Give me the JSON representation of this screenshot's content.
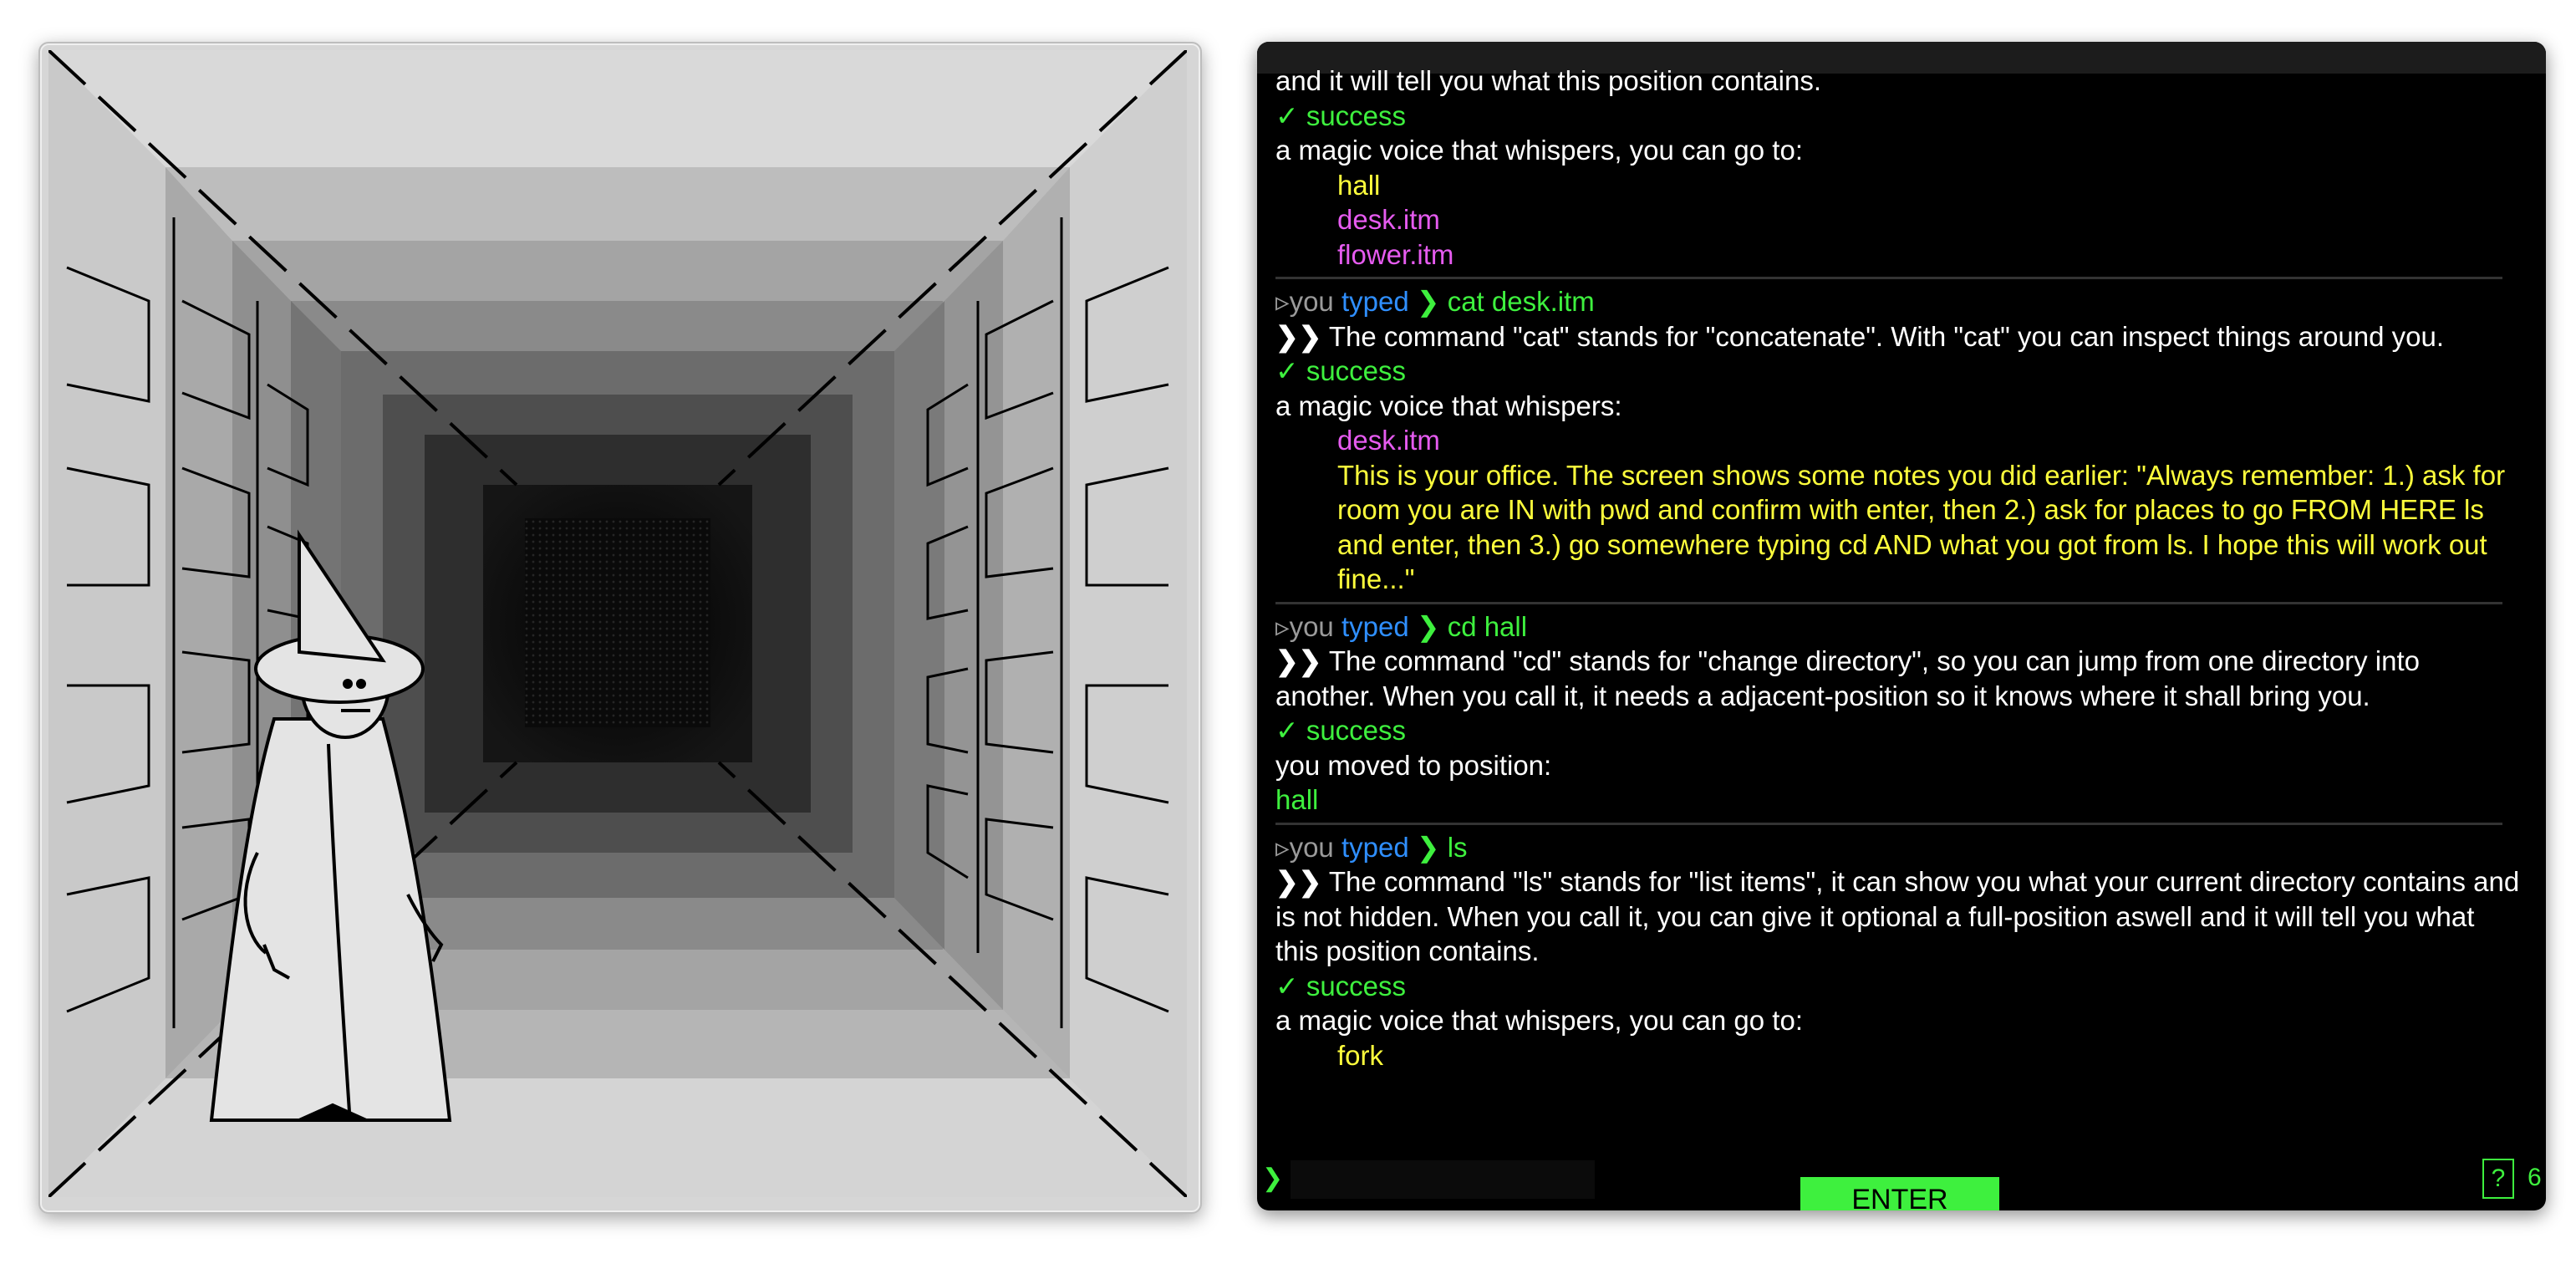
{
  "colors": {
    "terminal_bg": "#000000",
    "success": "#3ef03e",
    "highlight_yellow": "#ffff3c",
    "item_magenta": "#e65bf0",
    "typed_blue": "#2f8fff",
    "enter_button": "#3ef03e"
  },
  "game": {
    "scene": "stone corridor with wizard",
    "character_icon": "wizard-icon"
  },
  "terminal": {
    "block0": {
      "cont": "and it will tell you what this position contains.",
      "success": "✓ success",
      "voice": "a magic voice that whispers, you can go to:",
      "items": [
        "hall",
        "desk.itm",
        "flower.itm"
      ]
    },
    "block1": {
      "prefix": "▹you",
      "typed": "typed",
      "chev": "❯",
      "cmd": "cat desk.itm",
      "arrows": "❯❯",
      "explain": " The command \"cat\" stands for \"concatenate\". With \"cat\" you can inspect things around you.",
      "success": "✓ success",
      "voice": "a magic voice that whispers:",
      "item": "desk.itm",
      "note": "This is your office. The screen shows some notes you did earlier: \"Always remember: 1.) ask for room you are IN with pwd and confirm with enter, then 2.) ask for places to go FROM HERE ls and enter, then 3.) go somewhere typing cd AND what you got from ls. I hope this will work out fine...\""
    },
    "block2": {
      "prefix": "▹you",
      "typed": "typed",
      "chev": "❯",
      "cmd": "cd hall",
      "arrows": "❯❯",
      "explain": " The command \"cd\" stands for \"change directory\", so you can jump from one directory into another. When you call it, it needs a adjacent-position so it knows where it shall bring you.",
      "success": "✓ success",
      "moved": "you moved to position:",
      "position": "hall"
    },
    "block3": {
      "prefix": "▹you",
      "typed": "typed",
      "chev": "❯",
      "cmd": "ls",
      "arrows": "❯❯",
      "explain": " The command \"ls\" stands for \"list items\", it can show you what your current directory contains and is not hidden. When you call it, you can give it optional a full-position aswell and it will tell you what this position contains.",
      "success": "✓ success",
      "voice": "a magic voice that whispers, you can go to:",
      "item": "fork"
    },
    "prompt": {
      "symbol": "❯",
      "value": "",
      "help_label": "?",
      "counter": "6",
      "enter_label": "ENTER"
    }
  }
}
